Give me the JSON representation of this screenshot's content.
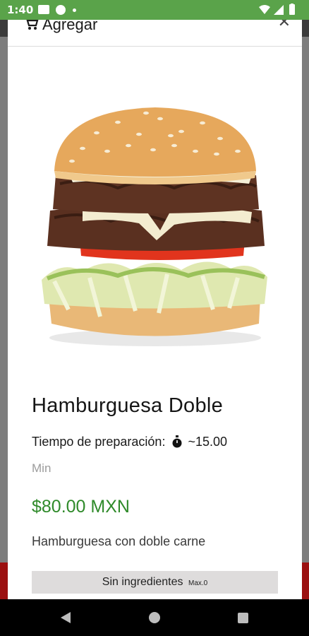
{
  "status_bar": {
    "time": "1:40",
    "left_icons": [
      "youtube-icon",
      "pocket-casts-icon",
      "notification-dot-icon"
    ],
    "right_icons": [
      "wifi-icon",
      "signal-icon",
      "battery-icon"
    ],
    "color": "#5aa34a"
  },
  "modal": {
    "header": {
      "label": "Agregar",
      "icon": "cart-icon",
      "close_icon": "close-icon"
    },
    "product": {
      "image": "burger-image",
      "name": "Hamburguesa Doble",
      "prep_label": "Tiempo de preparación:",
      "prep_time": "~15.00",
      "prep_unit": "Min",
      "price": "$80.00 MXN",
      "price_color": "#2f8a2a",
      "description": "Hamburguesa con doble carne"
    },
    "ingredients": {
      "label": "Sin ingredientes",
      "max_label": "Max.0"
    }
  },
  "nav_bar": {
    "icons": [
      "back-icon",
      "home-icon",
      "recents-icon"
    ]
  }
}
